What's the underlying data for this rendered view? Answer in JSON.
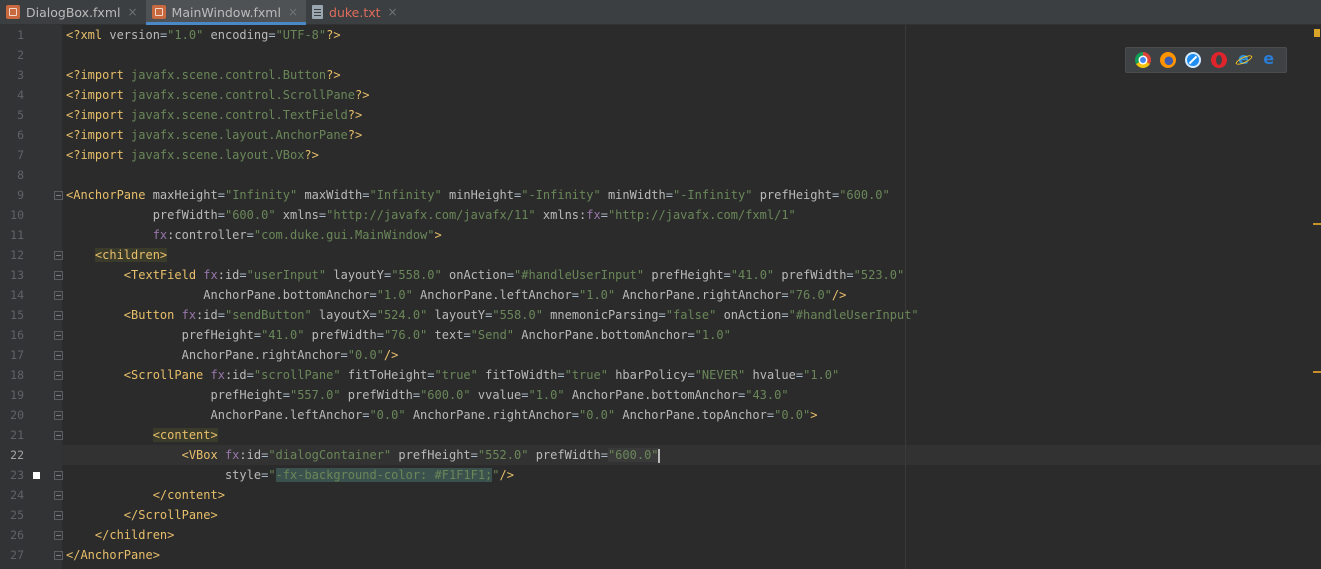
{
  "tabs": [
    {
      "label": "DialogBox.fxml",
      "icon": "fxml-file-icon",
      "active": false
    },
    {
      "label": "MainWindow.fxml",
      "icon": "fxml-file-icon",
      "active": true
    },
    {
      "label": "duke.txt",
      "icon": "text-file-icon",
      "active": false
    }
  ],
  "tab_close_glyph": "×",
  "browsers": [
    "chrome-icon",
    "firefox-icon",
    "safari-icon",
    "opera-icon",
    "internet-explorer-icon",
    "edge-icon"
  ],
  "editor": {
    "current_line": 22,
    "lines": [
      [
        {
          "t": "<?xml ",
          "c": "pi"
        },
        {
          "t": "version",
          "c": "attr"
        },
        {
          "t": "=",
          "c": "txt"
        },
        {
          "t": "\"1.0\"",
          "c": "val"
        },
        {
          "t": " ",
          "c": "txt"
        },
        {
          "t": "encoding",
          "c": "attr"
        },
        {
          "t": "=",
          "c": "txt"
        },
        {
          "t": "\"UTF-8\"",
          "c": "val"
        },
        {
          "t": "?>",
          "c": "pi"
        }
      ],
      [],
      [
        {
          "t": "<?import ",
          "c": "pi"
        },
        {
          "t": "javafx.scene.control.Button",
          "c": "val"
        },
        {
          "t": "?>",
          "c": "pi"
        }
      ],
      [
        {
          "t": "<?import ",
          "c": "pi"
        },
        {
          "t": "javafx.scene.control.ScrollPane",
          "c": "val"
        },
        {
          "t": "?>",
          "c": "pi"
        }
      ],
      [
        {
          "t": "<?import ",
          "c": "pi"
        },
        {
          "t": "javafx.scene.control.TextField",
          "c": "val"
        },
        {
          "t": "?>",
          "c": "pi"
        }
      ],
      [
        {
          "t": "<?import ",
          "c": "pi"
        },
        {
          "t": "javafx.scene.layout.AnchorPane",
          "c": "val"
        },
        {
          "t": "?>",
          "c": "pi"
        }
      ],
      [
        {
          "t": "<?import ",
          "c": "pi"
        },
        {
          "t": "javafx.scene.layout.VBox",
          "c": "val"
        },
        {
          "t": "?>",
          "c": "pi"
        }
      ],
      [],
      [
        {
          "t": "<AnchorPane ",
          "c": "tag"
        },
        {
          "t": "maxHeight",
          "c": "attr"
        },
        {
          "t": "=",
          "c": "txt"
        },
        {
          "t": "\"Infinity\"",
          "c": "val"
        },
        {
          "t": " ",
          "c": "txt"
        },
        {
          "t": "maxWidth",
          "c": "attr"
        },
        {
          "t": "=",
          "c": "txt"
        },
        {
          "t": "\"Infinity\"",
          "c": "val"
        },
        {
          "t": " ",
          "c": "txt"
        },
        {
          "t": "minHeight",
          "c": "attr"
        },
        {
          "t": "=",
          "c": "txt"
        },
        {
          "t": "\"-Infinity\"",
          "c": "val"
        },
        {
          "t": " ",
          "c": "txt"
        },
        {
          "t": "minWidth",
          "c": "attr"
        },
        {
          "t": "=",
          "c": "txt"
        },
        {
          "t": "\"-Infinity\"",
          "c": "val"
        },
        {
          "t": " ",
          "c": "txt"
        },
        {
          "t": "prefHeight",
          "c": "attr"
        },
        {
          "t": "=",
          "c": "txt"
        },
        {
          "t": "\"600.0\"",
          "c": "val"
        }
      ],
      [
        {
          "t": "            ",
          "c": "txt"
        },
        {
          "t": "prefWidth",
          "c": "attr"
        },
        {
          "t": "=",
          "c": "txt"
        },
        {
          "t": "\"600.0\"",
          "c": "val"
        },
        {
          "t": " ",
          "c": "txt"
        },
        {
          "t": "xmlns",
          "c": "attr"
        },
        {
          "t": "=",
          "c": "txt"
        },
        {
          "t": "\"http://javafx.com/javafx/11\"",
          "c": "val"
        },
        {
          "t": " ",
          "c": "txt"
        },
        {
          "t": "xmlns:",
          "c": "attr"
        },
        {
          "t": "fx",
          "c": "ns"
        },
        {
          "t": "=",
          "c": "txt"
        },
        {
          "t": "\"http://javafx.com/fxml/1\"",
          "c": "val"
        }
      ],
      [
        {
          "t": "            ",
          "c": "txt"
        },
        {
          "t": "fx",
          "c": "ns"
        },
        {
          "t": ":controller",
          "c": "attr"
        },
        {
          "t": "=",
          "c": "txt"
        },
        {
          "t": "\"com.duke.gui.MainWindow\"",
          "c": "val"
        },
        {
          "t": ">",
          "c": "tag"
        }
      ],
      [
        {
          "t": "    ",
          "c": "txt"
        },
        {
          "t": "<children>",
          "c": "tagbg"
        }
      ],
      [
        {
          "t": "        ",
          "c": "txt"
        },
        {
          "t": "<TextField ",
          "c": "tag"
        },
        {
          "t": "fx",
          "c": "ns"
        },
        {
          "t": ":id",
          "c": "attr"
        },
        {
          "t": "=",
          "c": "txt"
        },
        {
          "t": "\"userInput\"",
          "c": "val"
        },
        {
          "t": " ",
          "c": "txt"
        },
        {
          "t": "layoutY",
          "c": "attr"
        },
        {
          "t": "=",
          "c": "txt"
        },
        {
          "t": "\"558.0\"",
          "c": "val"
        },
        {
          "t": " ",
          "c": "txt"
        },
        {
          "t": "onAction",
          "c": "attr"
        },
        {
          "t": "=",
          "c": "txt"
        },
        {
          "t": "\"#handleUserInput\"",
          "c": "val"
        },
        {
          "t": " ",
          "c": "txt"
        },
        {
          "t": "prefHeight",
          "c": "attr"
        },
        {
          "t": "=",
          "c": "txt"
        },
        {
          "t": "\"41.0\"",
          "c": "val"
        },
        {
          "t": " ",
          "c": "txt"
        },
        {
          "t": "prefWidth",
          "c": "attr"
        },
        {
          "t": "=",
          "c": "txt"
        },
        {
          "t": "\"523.0\"",
          "c": "val"
        }
      ],
      [
        {
          "t": "                   ",
          "c": "txt"
        },
        {
          "t": "AnchorPane.bottomAnchor",
          "c": "attr"
        },
        {
          "t": "=",
          "c": "txt"
        },
        {
          "t": "\"1.0\"",
          "c": "val"
        },
        {
          "t": " ",
          "c": "txt"
        },
        {
          "t": "AnchorPane.leftAnchor",
          "c": "attr"
        },
        {
          "t": "=",
          "c": "txt"
        },
        {
          "t": "\"1.0\"",
          "c": "val"
        },
        {
          "t": " ",
          "c": "txt"
        },
        {
          "t": "AnchorPane.rightAnchor",
          "c": "attr"
        },
        {
          "t": "=",
          "c": "txt"
        },
        {
          "t": "\"76.0\"",
          "c": "val"
        },
        {
          "t": "/>",
          "c": "tag"
        }
      ],
      [
        {
          "t": "        ",
          "c": "txt"
        },
        {
          "t": "<Button ",
          "c": "tag"
        },
        {
          "t": "fx",
          "c": "ns"
        },
        {
          "t": ":id",
          "c": "attr"
        },
        {
          "t": "=",
          "c": "txt"
        },
        {
          "t": "\"sendButton\"",
          "c": "val"
        },
        {
          "t": " ",
          "c": "txt"
        },
        {
          "t": "layoutX",
          "c": "attr"
        },
        {
          "t": "=",
          "c": "txt"
        },
        {
          "t": "\"524.0\"",
          "c": "val"
        },
        {
          "t": " ",
          "c": "txt"
        },
        {
          "t": "layoutY",
          "c": "attr"
        },
        {
          "t": "=",
          "c": "txt"
        },
        {
          "t": "\"558.0\"",
          "c": "val"
        },
        {
          "t": " ",
          "c": "txt"
        },
        {
          "t": "mnemonicParsing",
          "c": "attr"
        },
        {
          "t": "=",
          "c": "txt"
        },
        {
          "t": "\"false\"",
          "c": "val"
        },
        {
          "t": " ",
          "c": "txt"
        },
        {
          "t": "onAction",
          "c": "attr"
        },
        {
          "t": "=",
          "c": "txt"
        },
        {
          "t": "\"#handleUserInput\"",
          "c": "val"
        }
      ],
      [
        {
          "t": "                ",
          "c": "txt"
        },
        {
          "t": "prefHeight",
          "c": "attr"
        },
        {
          "t": "=",
          "c": "txt"
        },
        {
          "t": "\"41.0\"",
          "c": "val"
        },
        {
          "t": " ",
          "c": "txt"
        },
        {
          "t": "prefWidth",
          "c": "attr"
        },
        {
          "t": "=",
          "c": "txt"
        },
        {
          "t": "\"76.0\"",
          "c": "val"
        },
        {
          "t": " ",
          "c": "txt"
        },
        {
          "t": "text",
          "c": "attr"
        },
        {
          "t": "=",
          "c": "txt"
        },
        {
          "t": "\"Send\"",
          "c": "val"
        },
        {
          "t": " ",
          "c": "txt"
        },
        {
          "t": "AnchorPane.bottomAnchor",
          "c": "attr"
        },
        {
          "t": "=",
          "c": "txt"
        },
        {
          "t": "\"1.0\"",
          "c": "val"
        }
      ],
      [
        {
          "t": "                ",
          "c": "txt"
        },
        {
          "t": "AnchorPane.rightAnchor",
          "c": "attr"
        },
        {
          "t": "=",
          "c": "txt"
        },
        {
          "t": "\"0.0\"",
          "c": "val"
        },
        {
          "t": "/>",
          "c": "tag"
        }
      ],
      [
        {
          "t": "        ",
          "c": "txt"
        },
        {
          "t": "<ScrollPane ",
          "c": "tag"
        },
        {
          "t": "fx",
          "c": "ns"
        },
        {
          "t": ":id",
          "c": "attr"
        },
        {
          "t": "=",
          "c": "txt"
        },
        {
          "t": "\"scrollPane\"",
          "c": "val"
        },
        {
          "t": " ",
          "c": "txt"
        },
        {
          "t": "fitToHeight",
          "c": "attr"
        },
        {
          "t": "=",
          "c": "txt"
        },
        {
          "t": "\"true\"",
          "c": "val"
        },
        {
          "t": " ",
          "c": "txt"
        },
        {
          "t": "fitToWidth",
          "c": "attr"
        },
        {
          "t": "=",
          "c": "txt"
        },
        {
          "t": "\"true\"",
          "c": "val"
        },
        {
          "t": " ",
          "c": "txt"
        },
        {
          "t": "hbarPolicy",
          "c": "attr"
        },
        {
          "t": "=",
          "c": "txt"
        },
        {
          "t": "\"NEVER\"",
          "c": "val"
        },
        {
          "t": " ",
          "c": "txt"
        },
        {
          "t": "hvalue",
          "c": "attr"
        },
        {
          "t": "=",
          "c": "txt"
        },
        {
          "t": "\"1.0\"",
          "c": "val"
        }
      ],
      [
        {
          "t": "                    ",
          "c": "txt"
        },
        {
          "t": "prefHeight",
          "c": "attr"
        },
        {
          "t": "=",
          "c": "txt"
        },
        {
          "t": "\"557.0\"",
          "c": "val"
        },
        {
          "t": " ",
          "c": "txt"
        },
        {
          "t": "prefWidth",
          "c": "attr"
        },
        {
          "t": "=",
          "c": "txt"
        },
        {
          "t": "\"600.0\"",
          "c": "val"
        },
        {
          "t": " ",
          "c": "txt"
        },
        {
          "t": "vvalue",
          "c": "attr"
        },
        {
          "t": "=",
          "c": "txt"
        },
        {
          "t": "\"1.0\"",
          "c": "val"
        },
        {
          "t": " ",
          "c": "txt"
        },
        {
          "t": "AnchorPane.bottomAnchor",
          "c": "attr"
        },
        {
          "t": "=",
          "c": "txt"
        },
        {
          "t": "\"43.0\"",
          "c": "val"
        }
      ],
      [
        {
          "t": "                    ",
          "c": "txt"
        },
        {
          "t": "AnchorPane.leftAnchor",
          "c": "attr"
        },
        {
          "t": "=",
          "c": "txt"
        },
        {
          "t": "\"0.0\"",
          "c": "val"
        },
        {
          "t": " ",
          "c": "txt"
        },
        {
          "t": "AnchorPane.rightAnchor",
          "c": "attr"
        },
        {
          "t": "=",
          "c": "txt"
        },
        {
          "t": "\"0.0\"",
          "c": "val"
        },
        {
          "t": " ",
          "c": "txt"
        },
        {
          "t": "AnchorPane.topAnchor",
          "c": "attr"
        },
        {
          "t": "=",
          "c": "txt"
        },
        {
          "t": "\"0.0\"",
          "c": "val"
        },
        {
          "t": ">",
          "c": "tag"
        }
      ],
      [
        {
          "t": "            ",
          "c": "txt"
        },
        {
          "t": "<content>",
          "c": "tagbg"
        }
      ],
      [
        {
          "t": "                ",
          "c": "txt"
        },
        {
          "t": "<VBox ",
          "c": "tag"
        },
        {
          "t": "fx",
          "c": "ns"
        },
        {
          "t": ":id",
          "c": "attr"
        },
        {
          "t": "=",
          "c": "txt"
        },
        {
          "t": "\"dialogContainer\"",
          "c": "val"
        },
        {
          "t": " ",
          "c": "txt"
        },
        {
          "t": "prefHeight",
          "c": "attr"
        },
        {
          "t": "=",
          "c": "txt"
        },
        {
          "t": "\"552.0\"",
          "c": "val"
        },
        {
          "t": " ",
          "c": "txt"
        },
        {
          "t": "prefWidth",
          "c": "attr"
        },
        {
          "t": "=",
          "c": "txt"
        },
        {
          "t": "\"600.0\"",
          "c": "valmark"
        }
      ],
      [
        {
          "t": "                      ",
          "c": "txt"
        },
        {
          "t": "style",
          "c": "attr"
        },
        {
          "t": "=",
          "c": "txt"
        },
        {
          "t": "\"",
          "c": "val"
        },
        {
          "t": "-fx-background-color: #F1F1F1;",
          "c": "valhl"
        },
        {
          "t": "\"",
          "c": "val"
        },
        {
          "t": "/>",
          "c": "tag"
        }
      ],
      [
        {
          "t": "            ",
          "c": "txt"
        },
        {
          "t": "</content>",
          "c": "tag"
        }
      ],
      [
        {
          "t": "        ",
          "c": "txt"
        },
        {
          "t": "</ScrollPane>",
          "c": "tag"
        }
      ],
      [
        {
          "t": "    ",
          "c": "txt"
        },
        {
          "t": "</children>",
          "c": "tag"
        }
      ],
      [
        {
          "t": "</AnchorPane>",
          "c": "tag"
        }
      ]
    ]
  }
}
